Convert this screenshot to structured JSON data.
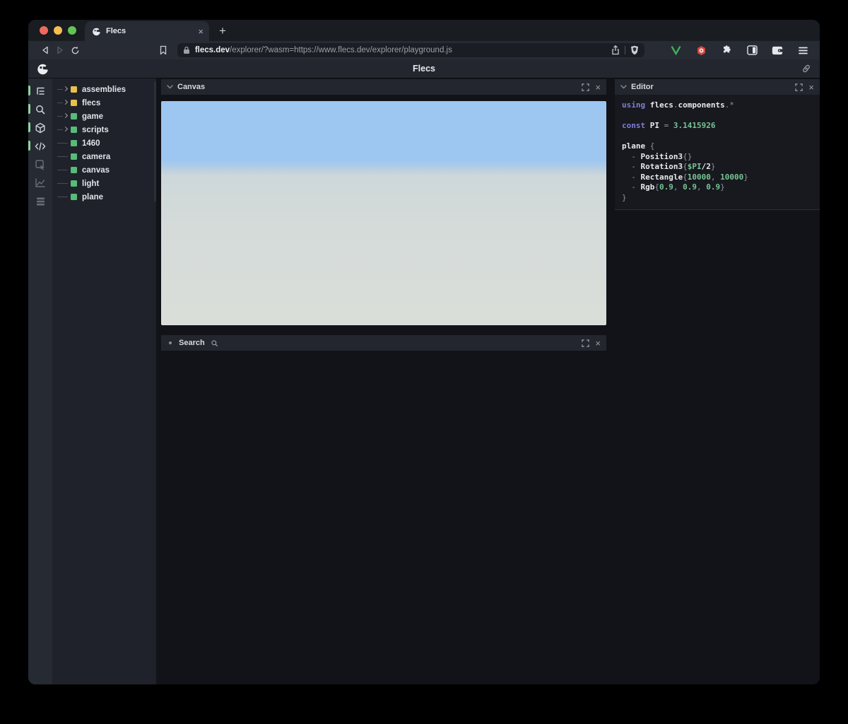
{
  "browser": {
    "traffic_lights": [
      "#ee6a5f",
      "#f5bd4f",
      "#61c554"
    ],
    "tab": {
      "title": "Flecs",
      "close_glyph": "×"
    },
    "new_tab_glyph": "+",
    "url": {
      "domain": "flecs.dev",
      "path": "/explorer/?wasm=https://www.flecs.dev/explorer/playground.js"
    },
    "toolbar_icons": [
      "back-icon",
      "forward-icon",
      "reload-icon",
      "bookmark-icon",
      "lock-icon",
      "share-icon",
      "brave-shield-icon",
      "extension-v-icon",
      "extension-red-icon",
      "extensions-puzzle-icon",
      "sidebar-icon",
      "wallet-icon",
      "menu-icon"
    ],
    "extension_v_color": "#3fae57",
    "extension_red_color": "#d2483f"
  },
  "header": {
    "title": "Flecs",
    "logo": "flecs-logo",
    "link_icon": "link-icon"
  },
  "sidebar": {
    "icons": [
      {
        "name": "tree-view-icon",
        "active": true
      },
      {
        "name": "search-icon",
        "active": true
      },
      {
        "name": "cube-icon",
        "active": true
      },
      {
        "name": "code-icon",
        "active": true
      },
      {
        "name": "inspector-icon",
        "active": false
      },
      {
        "name": "chart-icon",
        "active": false
      },
      {
        "name": "rows-icon",
        "active": false
      }
    ]
  },
  "tree": {
    "items": [
      {
        "label": "assemblies",
        "color": "#e7c14b",
        "expandable": true
      },
      {
        "label": "flecs",
        "color": "#e7c14b",
        "expandable": true
      },
      {
        "label": "game",
        "color": "#57bb79",
        "expandable": true
      },
      {
        "label": "scripts",
        "color": "#57bb79",
        "expandable": true
      },
      {
        "label": "1460",
        "color": "#57bb79",
        "expandable": false
      },
      {
        "label": "camera",
        "color": "#57bb79",
        "expandable": false
      },
      {
        "label": "canvas",
        "color": "#57bb79",
        "expandable": false
      },
      {
        "label": "light",
        "color": "#57bb79",
        "expandable": false
      },
      {
        "label": "plane",
        "color": "#57bb79",
        "expandable": false
      }
    ]
  },
  "panels": {
    "close_glyph": "×",
    "canvas": {
      "title": "Canvas"
    },
    "search": {
      "title": "Search"
    },
    "editor": {
      "title": "Editor",
      "code_lines": [
        [
          {
            "t": "using ",
            "c": "kw"
          },
          {
            "t": "flecs",
            "c": "id"
          },
          {
            "t": ".",
            "c": "pu"
          },
          {
            "t": "components",
            "c": "id"
          },
          {
            "t": ".*",
            "c": "pu"
          }
        ],
        [],
        [
          {
            "t": "const ",
            "c": "kw"
          },
          {
            "t": "PI ",
            "c": "id"
          },
          {
            "t": "= ",
            "c": "pu"
          },
          {
            "t": "3.1415926",
            "c": "num"
          }
        ],
        [],
        [
          {
            "t": "plane ",
            "c": "id"
          },
          {
            "t": "{",
            "c": "pu"
          }
        ],
        [
          {
            "t": "  - ",
            "c": "pu"
          },
          {
            "t": "Position3",
            "c": "id"
          },
          {
            "t": "{}",
            "c": "pu"
          }
        ],
        [
          {
            "t": "  - ",
            "c": "pu"
          },
          {
            "t": "Rotation3",
            "c": "id"
          },
          {
            "t": "{",
            "c": "pu"
          },
          {
            "t": "$PI",
            "c": "num"
          },
          {
            "t": "/2",
            "c": "id"
          },
          {
            "t": "}",
            "c": "pu"
          }
        ],
        [
          {
            "t": "  - ",
            "c": "pu"
          },
          {
            "t": "Rectangle",
            "c": "id"
          },
          {
            "t": "{",
            "c": "pu"
          },
          {
            "t": "10000",
            "c": "num"
          },
          {
            "t": ", ",
            "c": "pu"
          },
          {
            "t": "10000",
            "c": "num"
          },
          {
            "t": "}",
            "c": "pu"
          }
        ],
        [
          {
            "t": "  - ",
            "c": "pu"
          },
          {
            "t": "Rgb",
            "c": "id"
          },
          {
            "t": "{",
            "c": "pu"
          },
          {
            "t": "0.9",
            "c": "num"
          },
          {
            "t": ", ",
            "c": "pu"
          },
          {
            "t": "0.9",
            "c": "num"
          },
          {
            "t": ", ",
            "c": "pu"
          },
          {
            "t": "0.9",
            "c": "num"
          },
          {
            "t": "}",
            "c": "pu"
          }
        ],
        [
          {
            "t": "}",
            "c": "pu"
          }
        ]
      ]
    }
  },
  "scene": {
    "sky_color": "#9dc6f1",
    "ground_color": "#d6dcd9"
  }
}
